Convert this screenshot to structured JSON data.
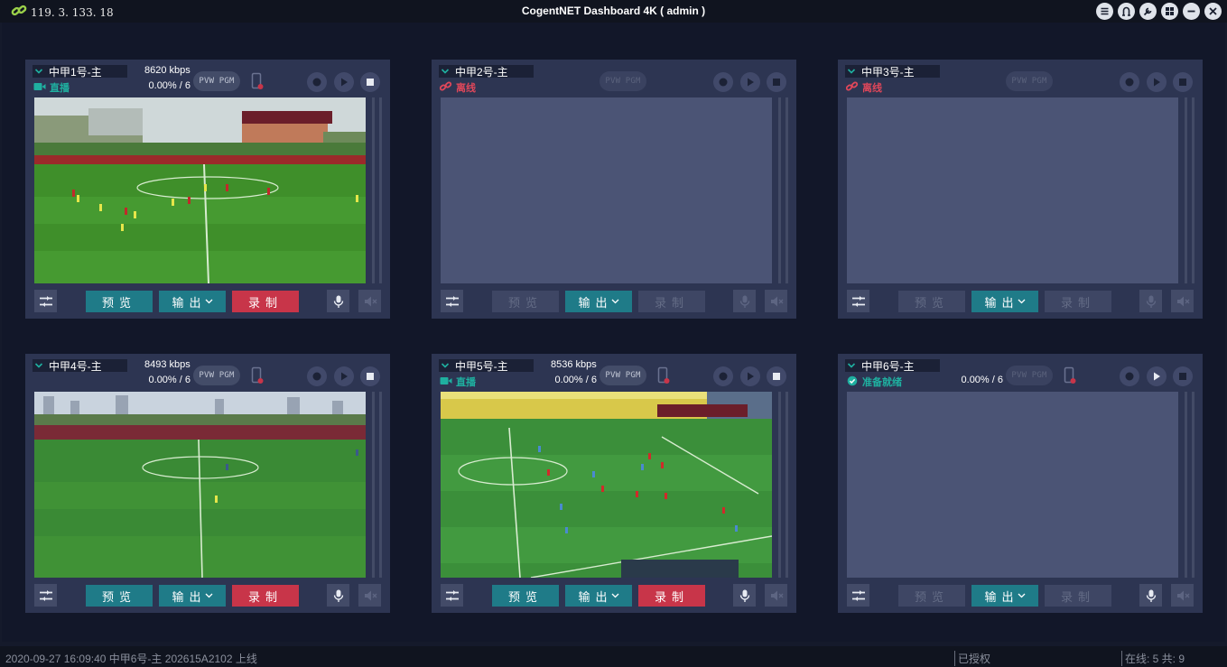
{
  "window": {
    "title": "CogentNET Dashboard 4K ( admin )",
    "ip": "119. 3. 133. 18",
    "buttons": [
      "menu-icon",
      "user-icon",
      "wrench-icon",
      "grid-icon",
      "minimize-icon",
      "close-icon"
    ]
  },
  "colors": {
    "accent_teal": "#1f7b88",
    "record_red": "#c83549",
    "live_green": "#1fb0a0",
    "offline_red": "#e0475a",
    "panel_bg": "#2d3552"
  },
  "common": {
    "preview_label": "预览",
    "output_label": "输出",
    "record_label": "录制",
    "pvw_pgm": "PVW PGM"
  },
  "panels": [
    {
      "name": "中甲1号-主",
      "kbps": "8620 kbps",
      "status": "直播",
      "status_icon": "camera-icon",
      "pct": "0.00% / 6",
      "video": "field-a",
      "active": true
    },
    {
      "name": "中甲2号-主",
      "kbps": "",
      "status": "离线",
      "status_icon": "broken-link-icon",
      "pct": "",
      "video": "none",
      "active": false
    },
    {
      "name": "中甲3号-主",
      "kbps": "",
      "status": "离线",
      "status_icon": "broken-link-icon",
      "pct": "",
      "video": "none",
      "active": false
    },
    {
      "name": "中甲4号-主",
      "kbps": "8493 kbps",
      "status": "",
      "status_icon": "",
      "pct": "0.00% / 6",
      "video": "field-b",
      "active": true
    },
    {
      "name": "中甲5号-主",
      "kbps": "8536 kbps",
      "status": "直播",
      "status_icon": "camera-icon",
      "pct": "0.00% / 6",
      "video": "field-c",
      "active": true
    },
    {
      "name": "中甲6号-主",
      "kbps": "",
      "status": "准备就绪",
      "status_icon": "check-icon",
      "pct": "0.00% / 6",
      "video": "none",
      "active": false
    }
  ],
  "footer": {
    "log": "2020-09-27 16:09:40 中甲6号-主 202615A2102 上线",
    "license": "已授权",
    "online": "在线: 5 共: 9"
  }
}
